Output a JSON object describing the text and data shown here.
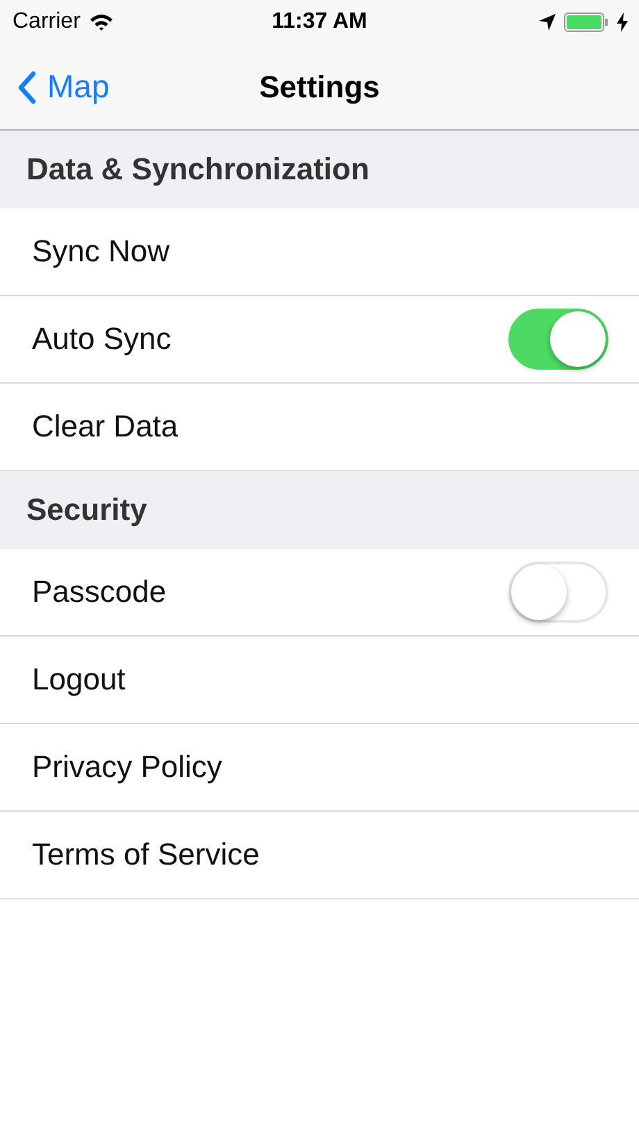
{
  "status_bar": {
    "carrier": "Carrier",
    "time": "11:37 AM"
  },
  "nav_bar": {
    "back": "Map",
    "title": "Settings"
  },
  "sections": [
    {
      "header": "Data & Synchronization",
      "rows": [
        {
          "label": "Sync Now",
          "kind": "plain"
        },
        {
          "label": "Auto Sync",
          "kind": "switch",
          "on": true
        },
        {
          "label": "Clear Data",
          "kind": "plain"
        }
      ]
    },
    {
      "header": "Security",
      "rows": [
        {
          "label": "Passcode",
          "kind": "switch",
          "on": false
        },
        {
          "label": "Logout",
          "kind": "plain"
        },
        {
          "label": "Privacy Policy",
          "kind": "plain"
        },
        {
          "label": "Terms of Service",
          "kind": "plain"
        }
      ]
    }
  ]
}
